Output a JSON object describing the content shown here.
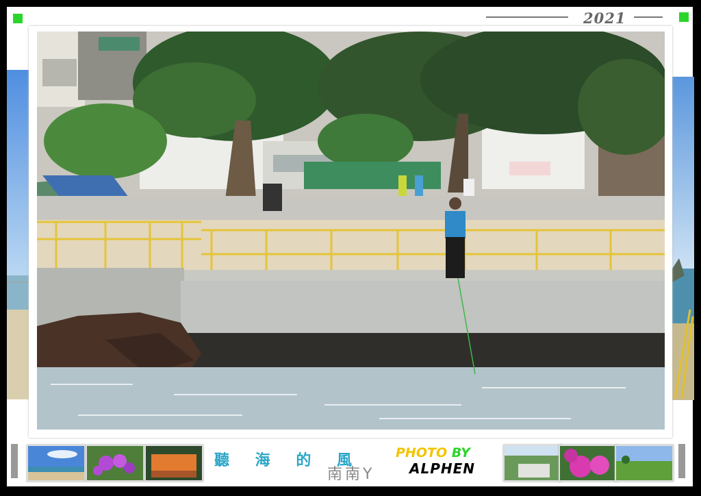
{
  "header": {
    "year": "2021",
    "accent_color": "#2bd62b"
  },
  "footer": {
    "caption": "聽 海 的 風",
    "author": "南南Y",
    "credit_prefix_1": "PHOTO",
    "credit_prefix_2": "BY",
    "credit_name": "ALPHEN"
  },
  "thumbnails_left": [
    "beach-scene",
    "purple-flowers",
    "orange-sign"
  ],
  "thumbnails_right": [
    "garden-path",
    "pink-bougainvillea",
    "green-field"
  ]
}
